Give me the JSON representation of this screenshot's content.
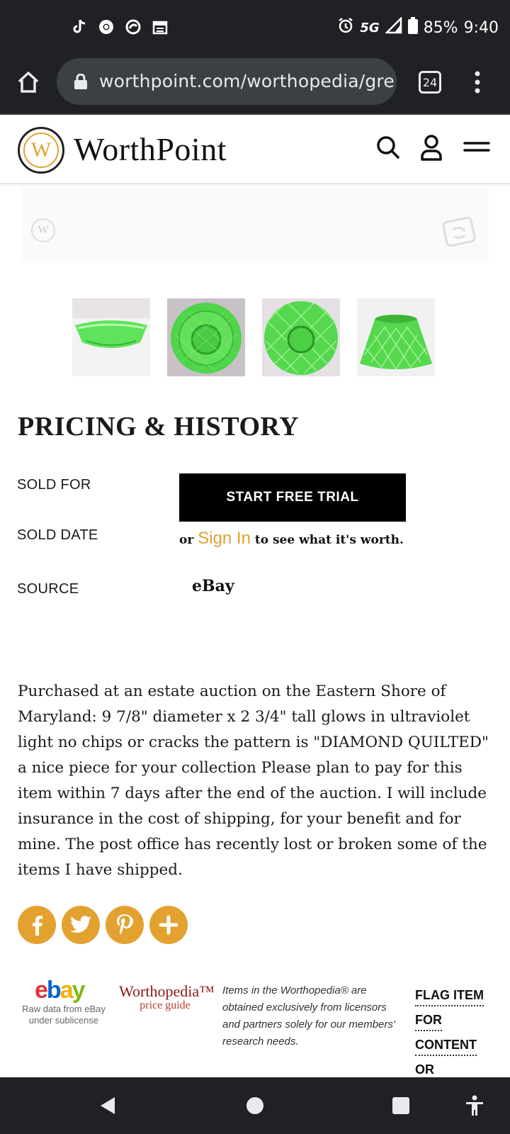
{
  "status_bar": {
    "battery": "85%",
    "time": "9:40",
    "network": "5G",
    "icons": [
      "tiktok-icon",
      "chrome-icon",
      "app-icon",
      "calendar-icon",
      "alarm-icon",
      "signal-icon",
      "battery-icon"
    ]
  },
  "browser": {
    "url": "worthpoint.com/worthopedia/gre",
    "tab_count": "24"
  },
  "site": {
    "brand": "WorthPoint",
    "logo_letter": "W"
  },
  "hero": {
    "watermark_letter": "W"
  },
  "thumbnails": [
    {
      "name": "thumbnail-side-view"
    },
    {
      "name": "thumbnail-top-view"
    },
    {
      "name": "thumbnail-top-view-2"
    },
    {
      "name": "thumbnail-angle-view"
    }
  ],
  "pricing": {
    "title": "PRICING & HISTORY",
    "sold_for_label": "SOLD FOR",
    "sold_date_label": "SOLD DATE",
    "source_label": "SOURCE",
    "trial_button": "START FREE TRIAL",
    "or_text": "or",
    "sign_in": "Sign In",
    "see_worth_text": "to see what it's worth.",
    "source_value": "eBay"
  },
  "description": "Purchased at an estate auction on the Eastern Shore of Maryland: 9 7/8\" diameter x 2 3/4\" tall glows in ultraviolet light no chips or cracks the pattern is \"DIAMOND QUILTED\" a nice piece for your collection Please plan to pay for this item within 7 days after the end of the auction. I will include insurance in the cost of shipping, for your benefit and for mine. The post office has recently lost or broken some of the items I have shipped.",
  "footer": {
    "ebay_logo": "ebay",
    "ebay_sub": "Raw data from eBay under sublicense",
    "worthopedia_title": "Worthopedia™",
    "worthopedia_sub": "price guide",
    "note": "Items in the Worthopedia® are obtained exclusively from licensors and partners solely for our members' research needs.",
    "flag_words": [
      "FLAG ITEM",
      "FOR",
      "CONTENT",
      "OR"
    ]
  },
  "colors": {
    "accent": "#e3a230",
    "glass_green": "#4fd44a",
    "chrome_dark": "#202124"
  }
}
